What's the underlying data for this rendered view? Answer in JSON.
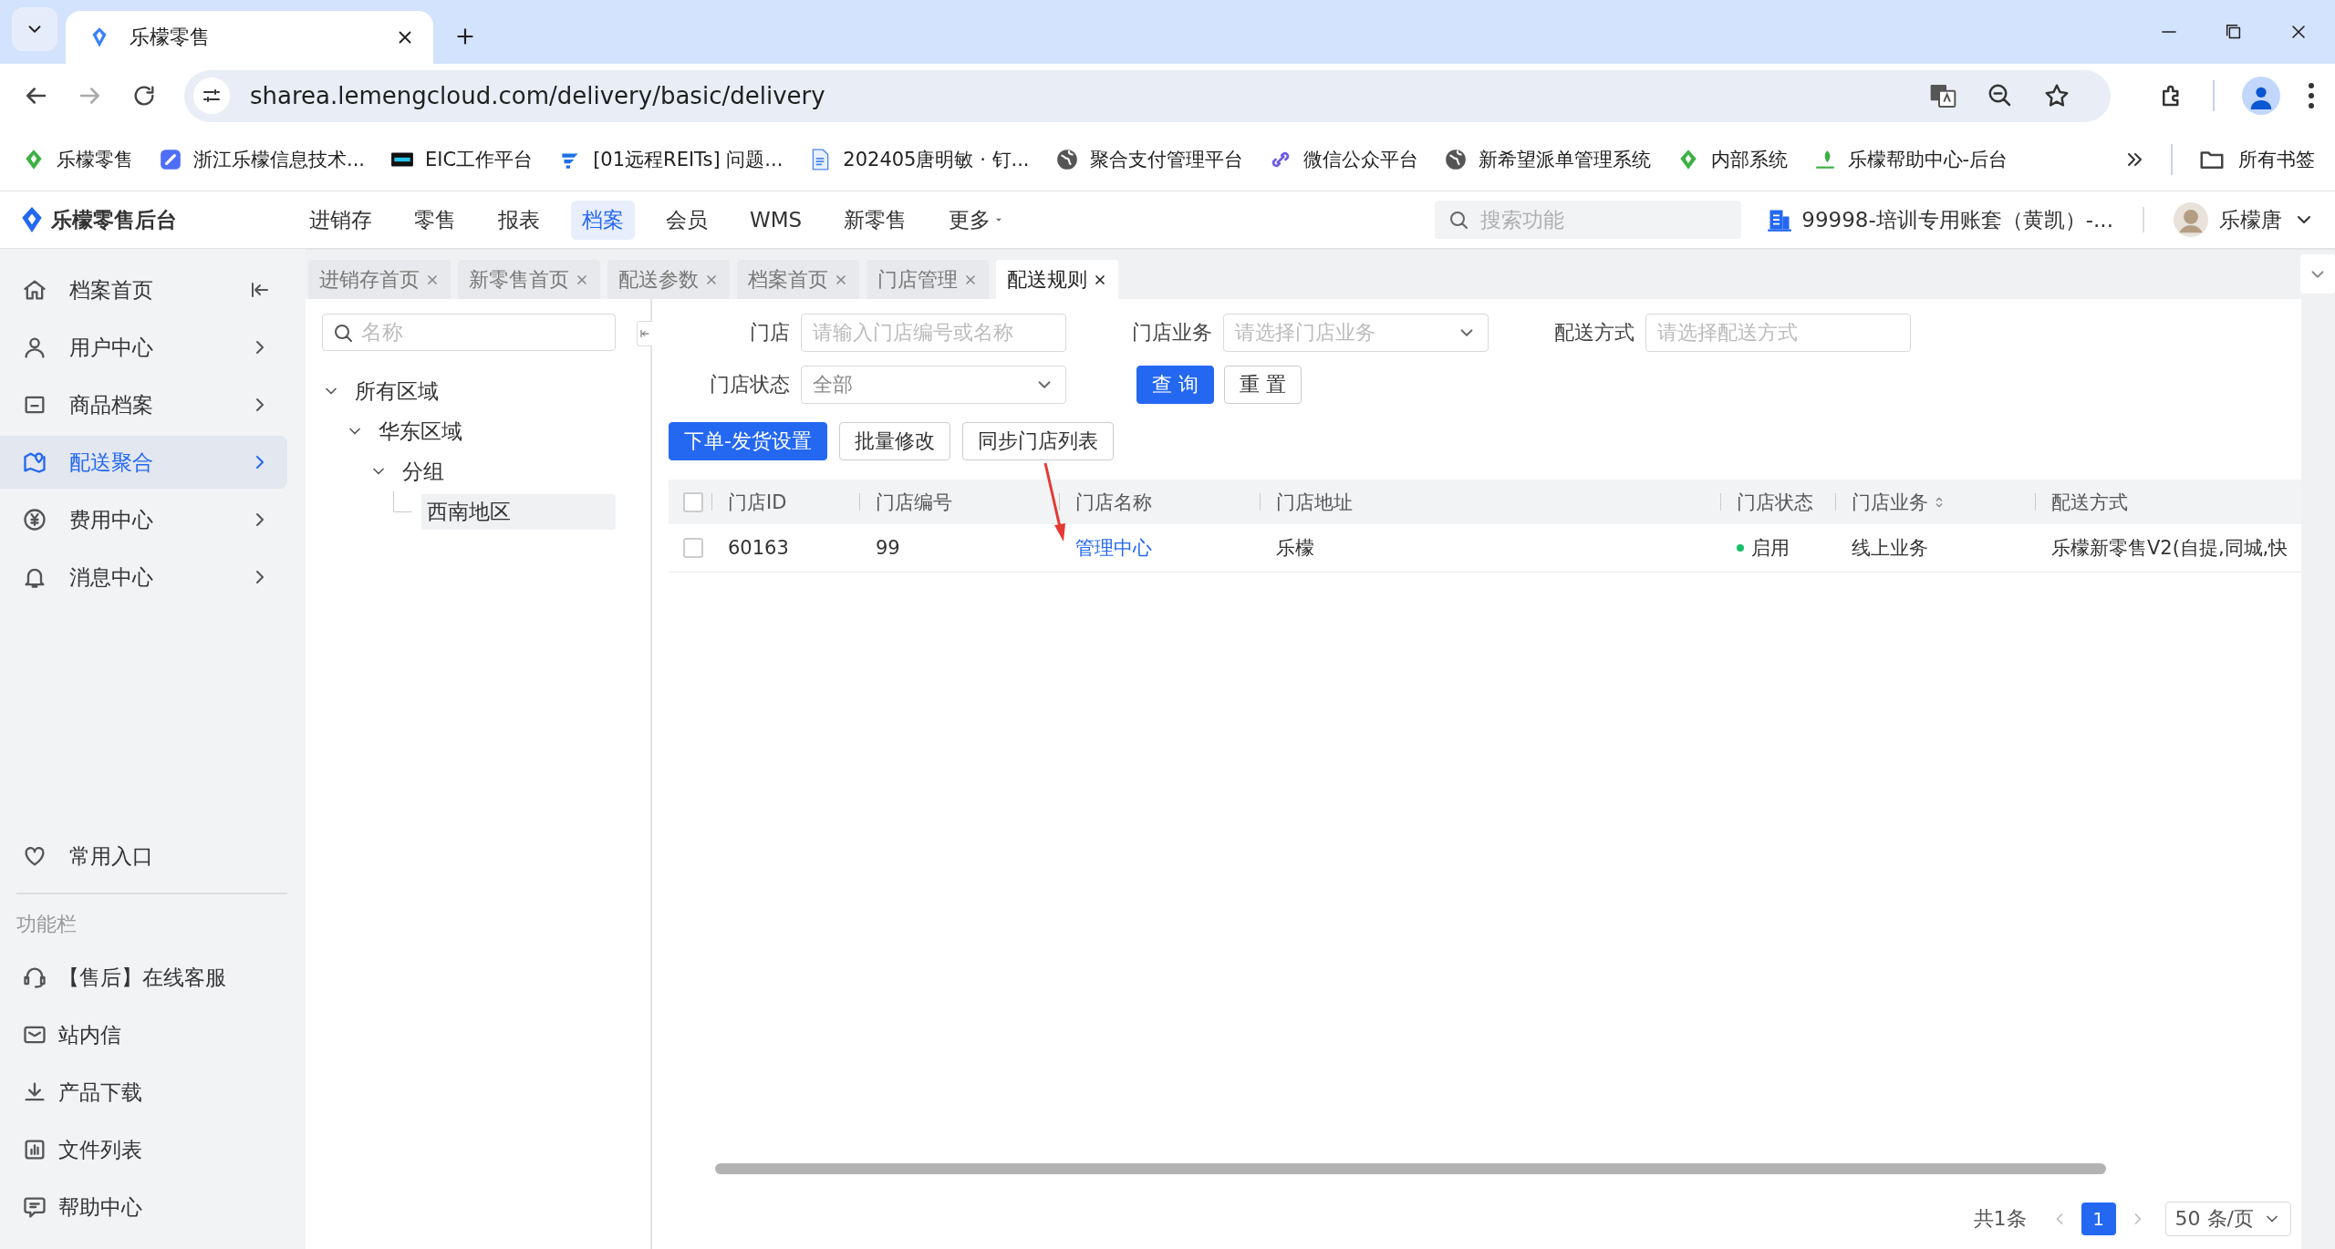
{
  "browser": {
    "tabs": [
      {
        "title": "乐檬零售",
        "selected": true
      }
    ],
    "url": "sharea.lemengcloud.com/delivery/basic/delivery",
    "bookmarks": [
      {
        "label": "乐檬零售"
      },
      {
        "label": "浙江乐檬信息技术..."
      },
      {
        "label": "EIC工作平台"
      },
      {
        "label": "[01远程REITs] 问题..."
      },
      {
        "label": "202405唐明敏 · 钉..."
      },
      {
        "label": "聚合支付管理平台"
      },
      {
        "label": "微信公众平台"
      },
      {
        "label": "新希望派单管理系统"
      },
      {
        "label": "内部系统"
      },
      {
        "label": "乐檬帮助中心-后台"
      }
    ],
    "all_bookmarks": "所有书签"
  },
  "app": {
    "logo": "乐檬零售后台",
    "nav": [
      {
        "label": "进销存",
        "selected": false
      },
      {
        "label": "零售",
        "selected": false
      },
      {
        "label": "报表",
        "selected": false
      },
      {
        "label": "档案",
        "selected": true
      },
      {
        "label": "会员",
        "selected": false
      },
      {
        "label": "WMS",
        "selected": false
      },
      {
        "label": "新零售",
        "selected": false
      },
      {
        "label": "更多",
        "selected": false
      }
    ],
    "search": {
      "placeholder": "搜索功能"
    },
    "account": "99998-培训专用账套（黄凯）-...",
    "user": "乐檬唐"
  },
  "sidebar": {
    "items": [
      {
        "label": "档案首页",
        "selected": false
      },
      {
        "label": "用户中心",
        "selected": false
      },
      {
        "label": "商品档案",
        "selected": false
      },
      {
        "label": "配送聚合",
        "selected": true
      },
      {
        "label": "费用中心",
        "selected": false
      },
      {
        "label": "消息中心",
        "selected": false
      }
    ],
    "favorites": "常用入口",
    "section": "功能栏",
    "tools": [
      {
        "label": "【售后】在线客服"
      },
      {
        "label": "站内信"
      },
      {
        "label": "产品下载"
      },
      {
        "label": "文件列表"
      },
      {
        "label": "帮助中心"
      }
    ]
  },
  "page_tabs": [
    {
      "label": "进销存首页",
      "selected": false
    },
    {
      "label": "新零售首页",
      "selected": false
    },
    {
      "label": "配送参数",
      "selected": false
    },
    {
      "label": "档案首页",
      "selected": false
    },
    {
      "label": "门店管理",
      "selected": false
    },
    {
      "label": "配送规则",
      "selected": true
    }
  ],
  "tree": {
    "search": {
      "placeholder": "名称"
    },
    "nodes": [
      {
        "label": "所有区域",
        "expanded": true,
        "selected": false,
        "children": [
          {
            "label": "华东区域",
            "expanded": true,
            "selected": false,
            "children": [
              {
                "label": "分组",
                "expanded": true,
                "selected": false,
                "children": [
                  {
                    "label": "西南地区",
                    "selected": true
                  }
                ]
              }
            ]
          }
        ]
      }
    ]
  },
  "filters": [
    {
      "label": "门店",
      "kind": "input",
      "placeholder": "请输入门店编号或名称"
    },
    {
      "label": "门店业务",
      "kind": "select",
      "placeholder": "请选择门店业务"
    },
    {
      "label": "配送方式",
      "kind": "input",
      "placeholder": "请选择配送方式"
    },
    {
      "label": "门店状态",
      "kind": "select",
      "value": "全部"
    }
  ],
  "query_buttons": [
    {
      "label": "查 询",
      "kind": "primary"
    },
    {
      "label": "重 置",
      "kind": "default"
    }
  ],
  "actions": [
    {
      "label": "下单-发货设置",
      "kind": "primary"
    },
    {
      "label": "批量修改",
      "kind": "default"
    },
    {
      "label": "同步门店列表",
      "kind": "default"
    }
  ],
  "table": {
    "all_checked": false,
    "columns": [
      {
        "label": "门店ID",
        "kind": "text"
      },
      {
        "label": "门店编号",
        "kind": "text"
      },
      {
        "label": "门店名称",
        "kind": "link"
      },
      {
        "label": "门店地址",
        "kind": "text"
      },
      {
        "label": "门店状态",
        "kind": "status"
      },
      {
        "label": "门店业务",
        "kind": "text",
        "sortable": true
      },
      {
        "label": "配送方式",
        "kind": "text"
      }
    ],
    "rows": [
      {
        "checked": false,
        "cells": [
          "60163",
          "99",
          "管理中心",
          "乐檬",
          "启用",
          "线上业务",
          "乐檬新零售V2(自提,同城,快"
        ]
      }
    ]
  },
  "pagination": {
    "total": "共1条",
    "pages": [
      {
        "label": "1",
        "selected": true
      }
    ],
    "page_size": "50 条/页"
  }
}
